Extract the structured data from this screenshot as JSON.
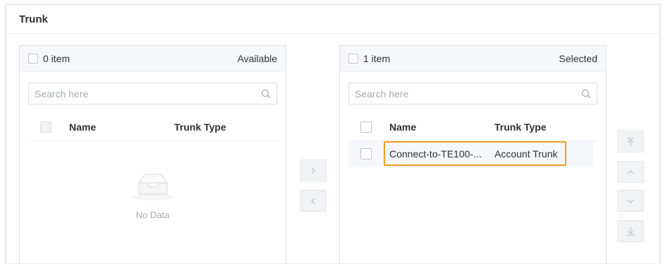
{
  "card": {
    "title": "Trunk"
  },
  "available": {
    "count_label": "0 item",
    "title": "Available",
    "search_placeholder": "Search here",
    "columns": {
      "name": "Name",
      "type": "Trunk Type"
    },
    "empty_text": "No Data"
  },
  "selected": {
    "count_label": "1 item",
    "title": "Selected",
    "search_placeholder": "Search here",
    "columns": {
      "name": "Name",
      "type": "Trunk Type"
    },
    "rows": [
      {
        "name": "Connect-to-TE100-...",
        "type": "Account Trunk"
      }
    ]
  },
  "icons": {
    "search": "search-icon",
    "move_right": "chevron-right-icon",
    "move_left": "chevron-left-icon",
    "move_top": "move-to-top-icon",
    "move_up": "chevron-up-icon",
    "move_down": "chevron-down-icon",
    "move_bottom": "move-to-bottom-icon",
    "empty": "empty-inbox-icon"
  },
  "colors": {
    "highlight": "#f0a020",
    "disabled_button": "#f2f3f5",
    "icon_gray": "#c0c4cc"
  }
}
